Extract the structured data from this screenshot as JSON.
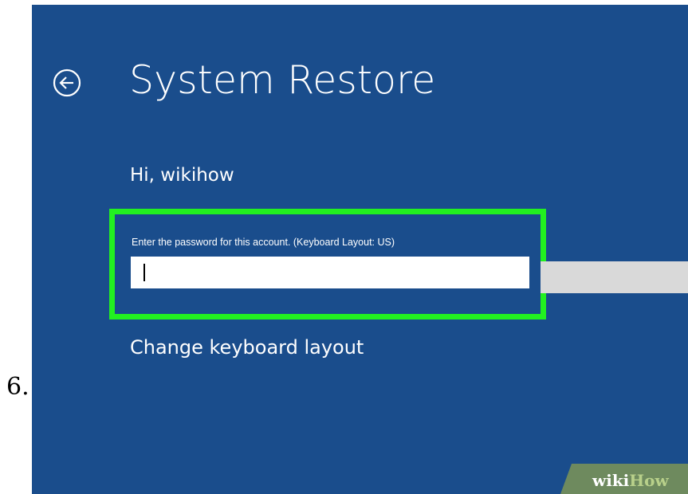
{
  "step_number": "6.",
  "screen": {
    "title": "System Restore",
    "greeting": "Hi, wikihow",
    "password_label": "Enter the password for this account. (Keyboard Layout: US)",
    "password_value": "",
    "change_keyboard_layout": "Change keyboard layout",
    "background_color": "#1a4d8c",
    "highlight_color": "#22f020"
  },
  "icons": {
    "back": "back-arrow-circle-icon"
  },
  "watermark": {
    "prefix": "wiki",
    "suffix": "How"
  }
}
